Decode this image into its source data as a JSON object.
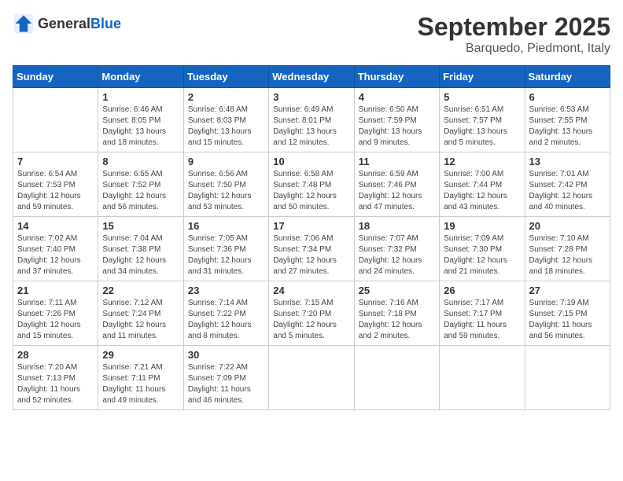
{
  "header": {
    "logo_general": "General",
    "logo_blue": "Blue",
    "month": "September 2025",
    "location": "Barquedo, Piedmont, Italy"
  },
  "weekdays": [
    "Sunday",
    "Monday",
    "Tuesday",
    "Wednesday",
    "Thursday",
    "Friday",
    "Saturday"
  ],
  "weeks": [
    [
      null,
      {
        "day": 1,
        "sunrise": "6:46 AM",
        "sunset": "8:05 PM",
        "daylight": "13 hours and 18 minutes."
      },
      {
        "day": 2,
        "sunrise": "6:48 AM",
        "sunset": "8:03 PM",
        "daylight": "13 hours and 15 minutes."
      },
      {
        "day": 3,
        "sunrise": "6:49 AM",
        "sunset": "8:01 PM",
        "daylight": "13 hours and 12 minutes."
      },
      {
        "day": 4,
        "sunrise": "6:50 AM",
        "sunset": "7:59 PM",
        "daylight": "13 hours and 9 minutes."
      },
      {
        "day": 5,
        "sunrise": "6:51 AM",
        "sunset": "7:57 PM",
        "daylight": "13 hours and 5 minutes."
      },
      {
        "day": 6,
        "sunrise": "6:53 AM",
        "sunset": "7:55 PM",
        "daylight": "13 hours and 2 minutes."
      }
    ],
    [
      {
        "day": 7,
        "sunrise": "6:54 AM",
        "sunset": "7:53 PM",
        "daylight": "12 hours and 59 minutes."
      },
      {
        "day": 8,
        "sunrise": "6:55 AM",
        "sunset": "7:52 PM",
        "daylight": "12 hours and 56 minutes."
      },
      {
        "day": 9,
        "sunrise": "6:56 AM",
        "sunset": "7:50 PM",
        "daylight": "12 hours and 53 minutes."
      },
      {
        "day": 10,
        "sunrise": "6:58 AM",
        "sunset": "7:48 PM",
        "daylight": "12 hours and 50 minutes."
      },
      {
        "day": 11,
        "sunrise": "6:59 AM",
        "sunset": "7:46 PM",
        "daylight": "12 hours and 47 minutes."
      },
      {
        "day": 12,
        "sunrise": "7:00 AM",
        "sunset": "7:44 PM",
        "daylight": "12 hours and 43 minutes."
      },
      {
        "day": 13,
        "sunrise": "7:01 AM",
        "sunset": "7:42 PM",
        "daylight": "12 hours and 40 minutes."
      }
    ],
    [
      {
        "day": 14,
        "sunrise": "7:02 AM",
        "sunset": "7:40 PM",
        "daylight": "12 hours and 37 minutes."
      },
      {
        "day": 15,
        "sunrise": "7:04 AM",
        "sunset": "7:38 PM",
        "daylight": "12 hours and 34 minutes."
      },
      {
        "day": 16,
        "sunrise": "7:05 AM",
        "sunset": "7:36 PM",
        "daylight": "12 hours and 31 minutes."
      },
      {
        "day": 17,
        "sunrise": "7:06 AM",
        "sunset": "7:34 PM",
        "daylight": "12 hours and 27 minutes."
      },
      {
        "day": 18,
        "sunrise": "7:07 AM",
        "sunset": "7:32 PM",
        "daylight": "12 hours and 24 minutes."
      },
      {
        "day": 19,
        "sunrise": "7:09 AM",
        "sunset": "7:30 PM",
        "daylight": "12 hours and 21 minutes."
      },
      {
        "day": 20,
        "sunrise": "7:10 AM",
        "sunset": "7:28 PM",
        "daylight": "12 hours and 18 minutes."
      }
    ],
    [
      {
        "day": 21,
        "sunrise": "7:11 AM",
        "sunset": "7:26 PM",
        "daylight": "12 hours and 15 minutes."
      },
      {
        "day": 22,
        "sunrise": "7:12 AM",
        "sunset": "7:24 PM",
        "daylight": "12 hours and 11 minutes."
      },
      {
        "day": 23,
        "sunrise": "7:14 AM",
        "sunset": "7:22 PM",
        "daylight": "12 hours and 8 minutes."
      },
      {
        "day": 24,
        "sunrise": "7:15 AM",
        "sunset": "7:20 PM",
        "daylight": "12 hours and 5 minutes."
      },
      {
        "day": 25,
        "sunrise": "7:16 AM",
        "sunset": "7:18 PM",
        "daylight": "12 hours and 2 minutes."
      },
      {
        "day": 26,
        "sunrise": "7:17 AM",
        "sunset": "7:17 PM",
        "daylight": "11 hours and 59 minutes."
      },
      {
        "day": 27,
        "sunrise": "7:19 AM",
        "sunset": "7:15 PM",
        "daylight": "11 hours and 56 minutes."
      }
    ],
    [
      {
        "day": 28,
        "sunrise": "7:20 AM",
        "sunset": "7:13 PM",
        "daylight": "11 hours and 52 minutes."
      },
      {
        "day": 29,
        "sunrise": "7:21 AM",
        "sunset": "7:11 PM",
        "daylight": "11 hours and 49 minutes."
      },
      {
        "day": 30,
        "sunrise": "7:22 AM",
        "sunset": "7:09 PM",
        "daylight": "11 hours and 46 minutes."
      },
      null,
      null,
      null,
      null
    ]
  ]
}
